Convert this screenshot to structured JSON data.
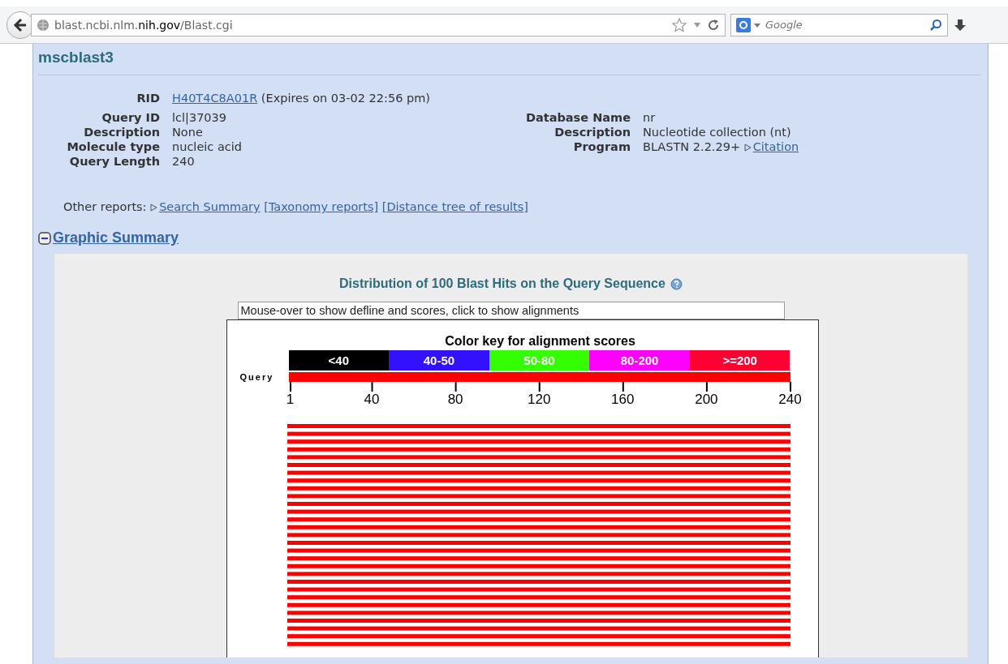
{
  "browser": {
    "url_host": "blast.ncbi.nlm.",
    "url_domain": "nih.gov",
    "url_path": "/Blast.cgi",
    "search_placeholder": "Google"
  },
  "page_title": "mscblast3",
  "rid": {
    "label": "RID",
    "value": "H40T4C8A01R",
    "note": "(Expires on 03-02 22:56 pm)"
  },
  "query_info": [
    {
      "label": "Query ID",
      "value": "lcl|37039"
    },
    {
      "label": "Description",
      "value": "None"
    },
    {
      "label": "Molecule type",
      "value": "nucleic acid"
    },
    {
      "label": "Query Length",
      "value": "240"
    }
  ],
  "database_info": [
    {
      "label": "Database Name",
      "value": "nr"
    },
    {
      "label": "Description",
      "value": "Nucleotide collection (nt)"
    },
    {
      "label": "Program",
      "value": "BLASTN 2.2.29+",
      "link": "Citation"
    }
  ],
  "other_reports": {
    "label": "Other reports:",
    "links": [
      "Search Summary",
      "[Taxonomy reports]",
      "[Distance tree of results]"
    ]
  },
  "graphic_summary": {
    "title": "Graphic Summary",
    "expanded": true,
    "heading": "Distribution of 100 Blast Hits on the Query Sequence",
    "info_text": "Mouse-over to show defline and scores, click to show alignments",
    "key_title": "Color key for alignment scores",
    "key": [
      {
        "label": "<40",
        "color": "#000000"
      },
      {
        "label": "40-50",
        "color": "#3311ff"
      },
      {
        "label": "50-80",
        "color": "#33ff00"
      },
      {
        "label": "80-200",
        "color": "#ff00ff"
      },
      {
        "label": ">=200",
        "color": "#ff0033"
      }
    ],
    "query_label": "Query",
    "ticks": [
      "1",
      "40",
      "80",
      "120",
      "160",
      "200",
      "240"
    ]
  }
}
